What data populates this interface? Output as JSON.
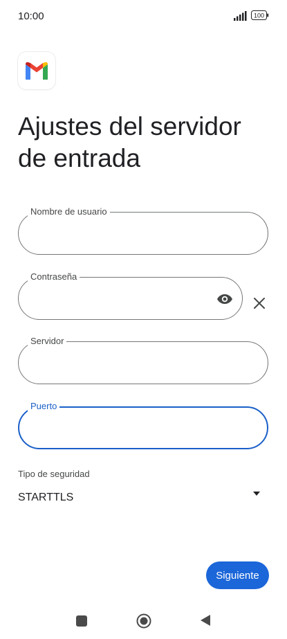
{
  "status_bar": {
    "time": "10:00",
    "battery": "100"
  },
  "app": {
    "logo_icon": "gmail-icon"
  },
  "page": {
    "title": "Ajustes del servidor de entrada"
  },
  "fields": {
    "username": {
      "label": "Nombre de usuario",
      "value": ""
    },
    "password": {
      "label": "Contraseña",
      "value": ""
    },
    "server": {
      "label": "Servidor",
      "value": ""
    },
    "port": {
      "label": "Puerto",
      "value": ""
    }
  },
  "security": {
    "label": "Tipo de seguridad",
    "selected": "STARTTLS"
  },
  "actions": {
    "next_label": "Siguiente"
  },
  "colors": {
    "accent": "#1b66d9",
    "focus": "#1a5fc9",
    "outline": "#747775"
  }
}
